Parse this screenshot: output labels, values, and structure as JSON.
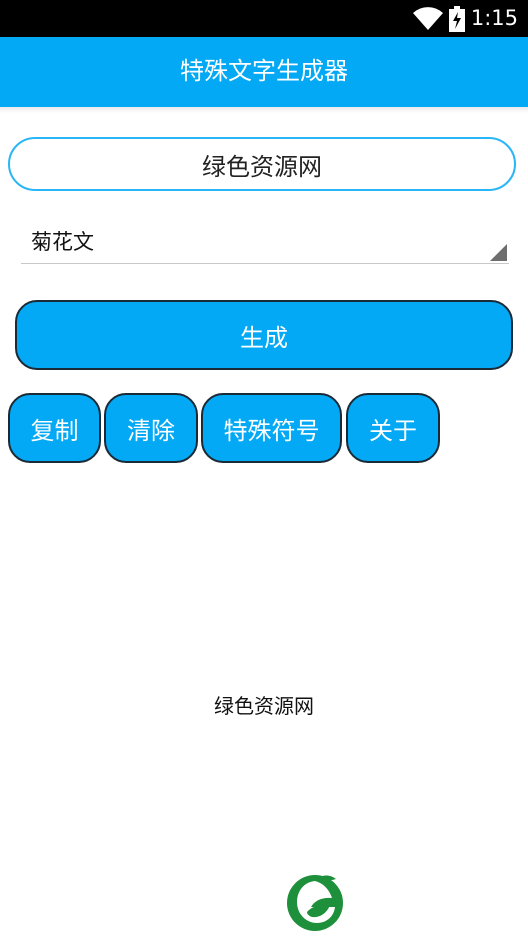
{
  "status_bar": {
    "time": "1:15",
    "icons": [
      "wifi-icon",
      "battery-charging-icon"
    ]
  },
  "app_bar": {
    "title": "特殊文字生成器"
  },
  "input": {
    "value": "绿色资源网",
    "placeholder": ""
  },
  "spinner": {
    "selected": "菊花文"
  },
  "buttons": {
    "generate": "生成",
    "copy": "复制",
    "clear": "清除",
    "special_symbols": "特殊符号",
    "about": "关于"
  },
  "output": {
    "text": "绿色资源网"
  },
  "colors": {
    "accent": "#03a9f4",
    "input_border": "#29b6f6",
    "button_border": "#1a2a36",
    "logo_green": "#1e8f3a"
  }
}
